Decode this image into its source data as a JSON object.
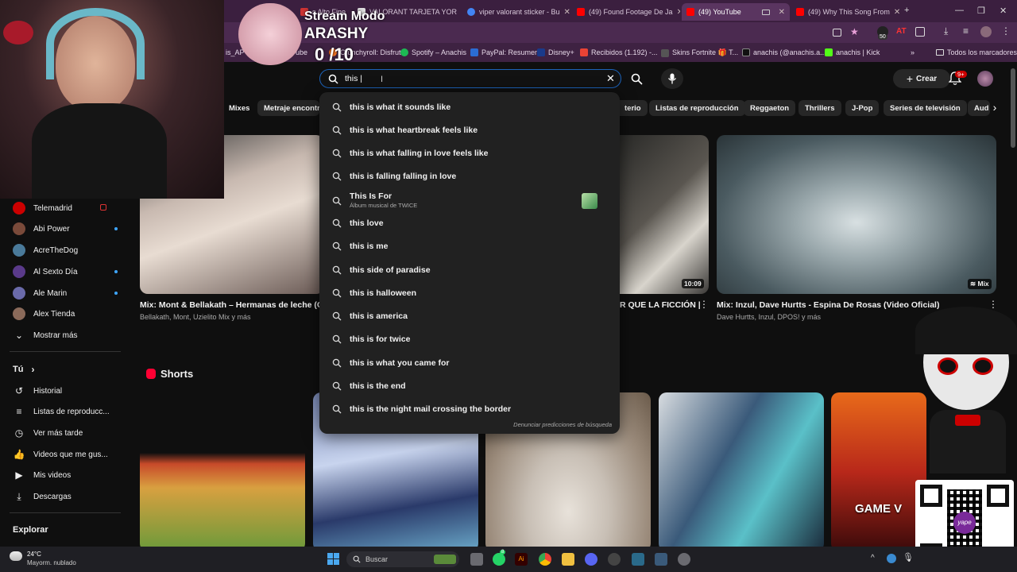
{
  "browser": {
    "tabs": [
      {
        "label": "s Alto Fine",
        "fav": "#c33"
      },
      {
        "label": "VALORANT TARJETA YOR",
        "fav": "#eee"
      },
      {
        "label": "viper valorant sticker - Bu",
        "fav": "#4285f4"
      },
      {
        "label": "(49) Found Footage De Ja",
        "fav": "#f00"
      },
      {
        "label": "(49) YouTube",
        "fav": "#f00"
      },
      {
        "label": "(49) Why This Song From",
        "fav": "#f00"
      }
    ],
    "bookmarks": [
      {
        "label": "is_AP",
        "fav": "#888"
      },
      {
        "label": "ube",
        "fav": "#888"
      },
      {
        "label": "Crunchyroll: Disfrut...",
        "fav": "#f47521"
      },
      {
        "label": "Spotify – Anachis",
        "fav": "#1db954"
      },
      {
        "label": "PayPal: Resumen",
        "fav": "#003087"
      },
      {
        "label": "Disney+",
        "fav": "#1a3a8a"
      },
      {
        "label": "Recibidos (1.192) -...",
        "fav": "#ea4335"
      },
      {
        "label": "Skins Fortnite 🎁 T...",
        "fav": "#555"
      },
      {
        "label": "anachis (@anachis.a...",
        "fav": "#000"
      },
      {
        "label": "anachis | Kick",
        "fav": "#53fc18"
      }
    ],
    "all_bookmarks": "Todos los marcadores",
    "ext_badge": "50"
  },
  "overlay": {
    "stream_title": "Stream Modo",
    "name": "ARASHY",
    "score": "0 /10",
    "qr_brand": "yape"
  },
  "youtube": {
    "search_value": "this |",
    "create_label": "Crear",
    "notif_count": "9+",
    "chips": [
      "Mixes",
      "Metraje encontra",
      "terio",
      "Listas de reproducción",
      "Reggaeton",
      "Thrillers",
      "J-Pop",
      "Series de televisión",
      "Aud"
    ],
    "suggestions": [
      "this is what it sounds like",
      "this is what heartbreak feels like",
      "this is what falling in love feels like",
      "this is falling falling in love",
      "This Is For",
      "this love",
      "this is me",
      "this side of paradise",
      "this is halloween",
      "this is america",
      "this is for twice",
      "this is what you came for",
      "this is the end",
      "this is the night mail crossing the border"
    ],
    "suggestion_sub": "Álbum musical de TWICE",
    "report_label": "Denunciar predicciones de búsqueda",
    "sidebar": {
      "subs": [
        {
          "label": "Telemadrid",
          "color": "#c00",
          "live": true
        },
        {
          "label": "Abi Power",
          "color": "#7a4a3a",
          "dot": true
        },
        {
          "label": "AcreTheDog",
          "color": "#4a7a9a",
          "dot": false
        },
        {
          "label": "Al Sexto Día",
          "color": "#5a3a8a",
          "dot": true
        },
        {
          "label": "Ale Marin",
          "color": "#6a6aaa",
          "dot": true
        },
        {
          "label": "Alex Tienda",
          "color": "#8a6a5a",
          "dot": false
        }
      ],
      "show_more": "Mostrar más",
      "you": "Tú",
      "you_items": [
        "Historial",
        "Listas de reproducc...",
        "Ver más tarde",
        "Videos que me gus...",
        "Mis videos",
        "Descargas"
      ],
      "explore": "Explorar"
    },
    "videos": [
      {
        "title": "Mix: Mont & Bellakath – Hermanas de leche (Of",
        "sub": "Bellakath, Mont, Uzielito Mix y más"
      },
      {
        "title": "R QUE LA FICCIÓN |",
        "sub": "",
        "duration": "10:09"
      },
      {
        "title": "Mix: Inzul, Dave Hurtts - Espina De Rosas (Video Oficial)",
        "sub": "Dave Hurtts, Inzul, DPOS! y más",
        "badge": "Mix"
      }
    ],
    "shorts_label": "Shorts",
    "shorts_overlay_text": "GAME V"
  },
  "taskbar": {
    "weather_temp": "24°C",
    "weather_desc": "Mayorm. nublado",
    "search_placeholder": "Buscar",
    "badge": "8"
  }
}
